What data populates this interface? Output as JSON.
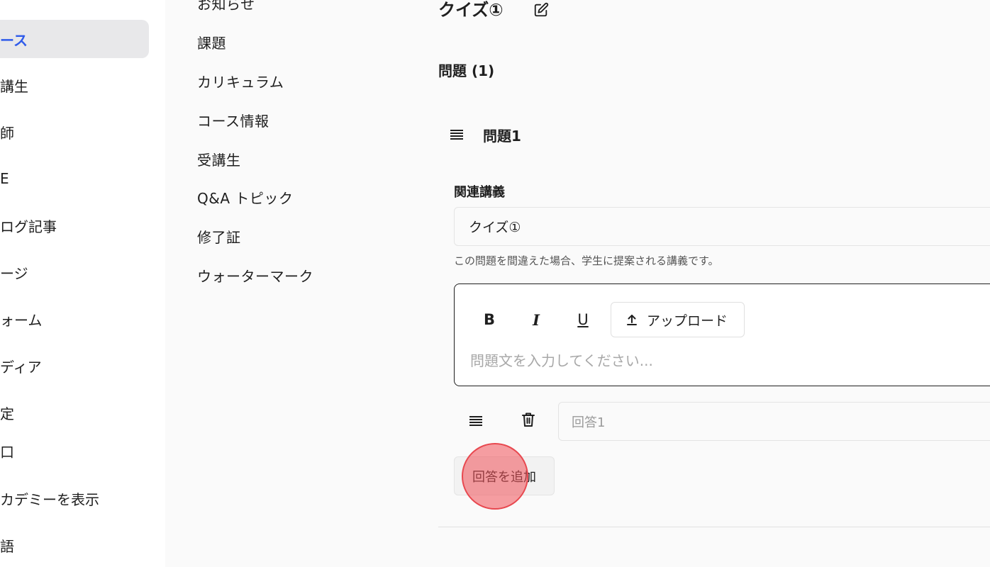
{
  "sidebar": {
    "items": [
      {
        "label": "ース",
        "active": true
      },
      {
        "label": "講生"
      },
      {
        "label": "師"
      },
      {
        "label": "E"
      },
      {
        "label": "ログ記事"
      },
      {
        "label": "ージ"
      },
      {
        "label": "ォーム"
      },
      {
        "label": "ディア"
      },
      {
        "label": "定"
      },
      {
        "label": "口"
      },
      {
        "label": "カデミーを表示"
      },
      {
        "label": "語"
      }
    ],
    "accent_color": "#2f5bea"
  },
  "course_nav": {
    "items": [
      {
        "label": "お知らせ"
      },
      {
        "label": "課題"
      },
      {
        "label": "カリキュラム"
      },
      {
        "label": "コース情報"
      },
      {
        "label": "受講生"
      },
      {
        "label": "Q&A トピック"
      },
      {
        "label": "修了証"
      },
      {
        "label": "ウォーターマーク"
      }
    ]
  },
  "quiz": {
    "title": "クイズ①",
    "edit_icon": "edit-icon",
    "questions_heading": "問題 (1)",
    "question": {
      "title": "問題1",
      "related_lecture_label": "関連講義",
      "related_lecture_value": "クイズ①",
      "related_lecture_help": "この問題を間違えた場合、学生に提案される講義です。",
      "editor": {
        "bold_label": "B",
        "italic_label": "I",
        "underline_label": "U",
        "upload_label": "アップロード",
        "placeholder": "問題文を入力してください..."
      },
      "answers": [
        {
          "placeholder": "回答1"
        }
      ],
      "add_answer_label": "回答を追加"
    }
  }
}
